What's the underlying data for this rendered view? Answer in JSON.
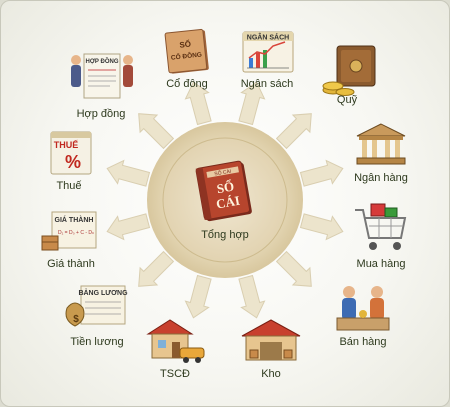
{
  "center": {
    "label": "Tổng hợp",
    "book_title_1": "SỔ",
    "book_title_2": "CÁI",
    "book_header": "SỐ CÁI"
  },
  "modules": [
    {
      "id": "co-dong",
      "label": "Cổ đông",
      "icon_text_1": "SỔ",
      "icon_text_2": "CỔ ĐÔNG"
    },
    {
      "id": "ngan-sach",
      "label": "Ngân sách",
      "icon_text_1": "NGÂN SÁCH"
    },
    {
      "id": "quy",
      "label": "Quỹ"
    },
    {
      "id": "hop-dong",
      "label": "Hợp đồng",
      "icon_text_1": "HỢP ĐỒNG"
    },
    {
      "id": "thue",
      "label": "Thuế",
      "icon_text_1": "THUẾ",
      "icon_text_2": "%"
    },
    {
      "id": "ngan-hang",
      "label": "Ngân hàng"
    },
    {
      "id": "gia-thanh",
      "label": "Giá thành",
      "icon_text_1": "GIÁ THÀNH",
      "icon_text_2": "D₁ = D₀ + C - Dₙ"
    },
    {
      "id": "mua-hang",
      "label": "Mua hàng"
    },
    {
      "id": "tien-luong",
      "label": "Tiền lương",
      "icon_text_1": "BẢNG LƯƠNG",
      "icon_text_2": "$"
    },
    {
      "id": "ban-hang",
      "label": "Bán hàng"
    },
    {
      "id": "tscd",
      "label": "TSCĐ"
    },
    {
      "id": "kho",
      "label": "Kho"
    }
  ]
}
